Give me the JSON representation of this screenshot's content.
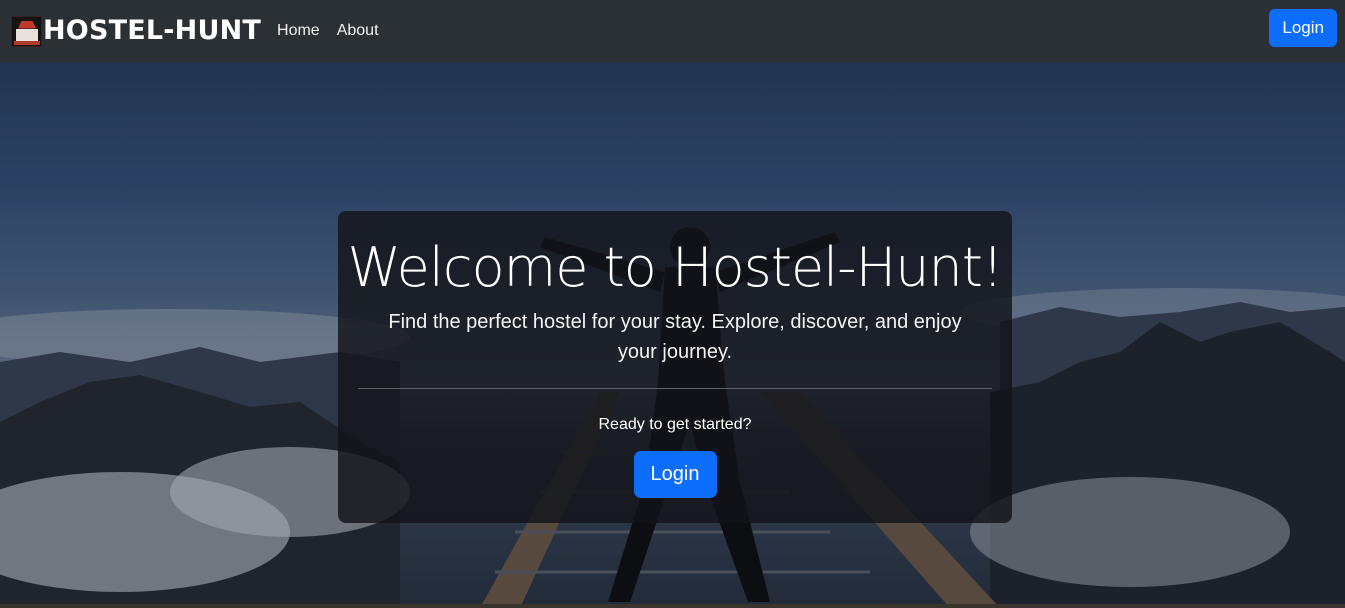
{
  "navbar": {
    "brand": "HOSTEL-HUNT",
    "links": [
      "Home",
      "About"
    ],
    "login_label": "Login"
  },
  "hero": {
    "title": "Welcome to Hostel-Hunt!",
    "lead": "Find the perfect hostel for your stay. Explore, discover, and enjoy your journey.",
    "prompt": "Ready to get started?",
    "cta_label": "Login"
  },
  "colors": {
    "navbar_bg": "#2b3035",
    "primary": "#0d6efd",
    "card_bg": "rgba(18,20,24,0.82)"
  },
  "icons": {
    "brand_logo": "hostel-logo-icon"
  }
}
